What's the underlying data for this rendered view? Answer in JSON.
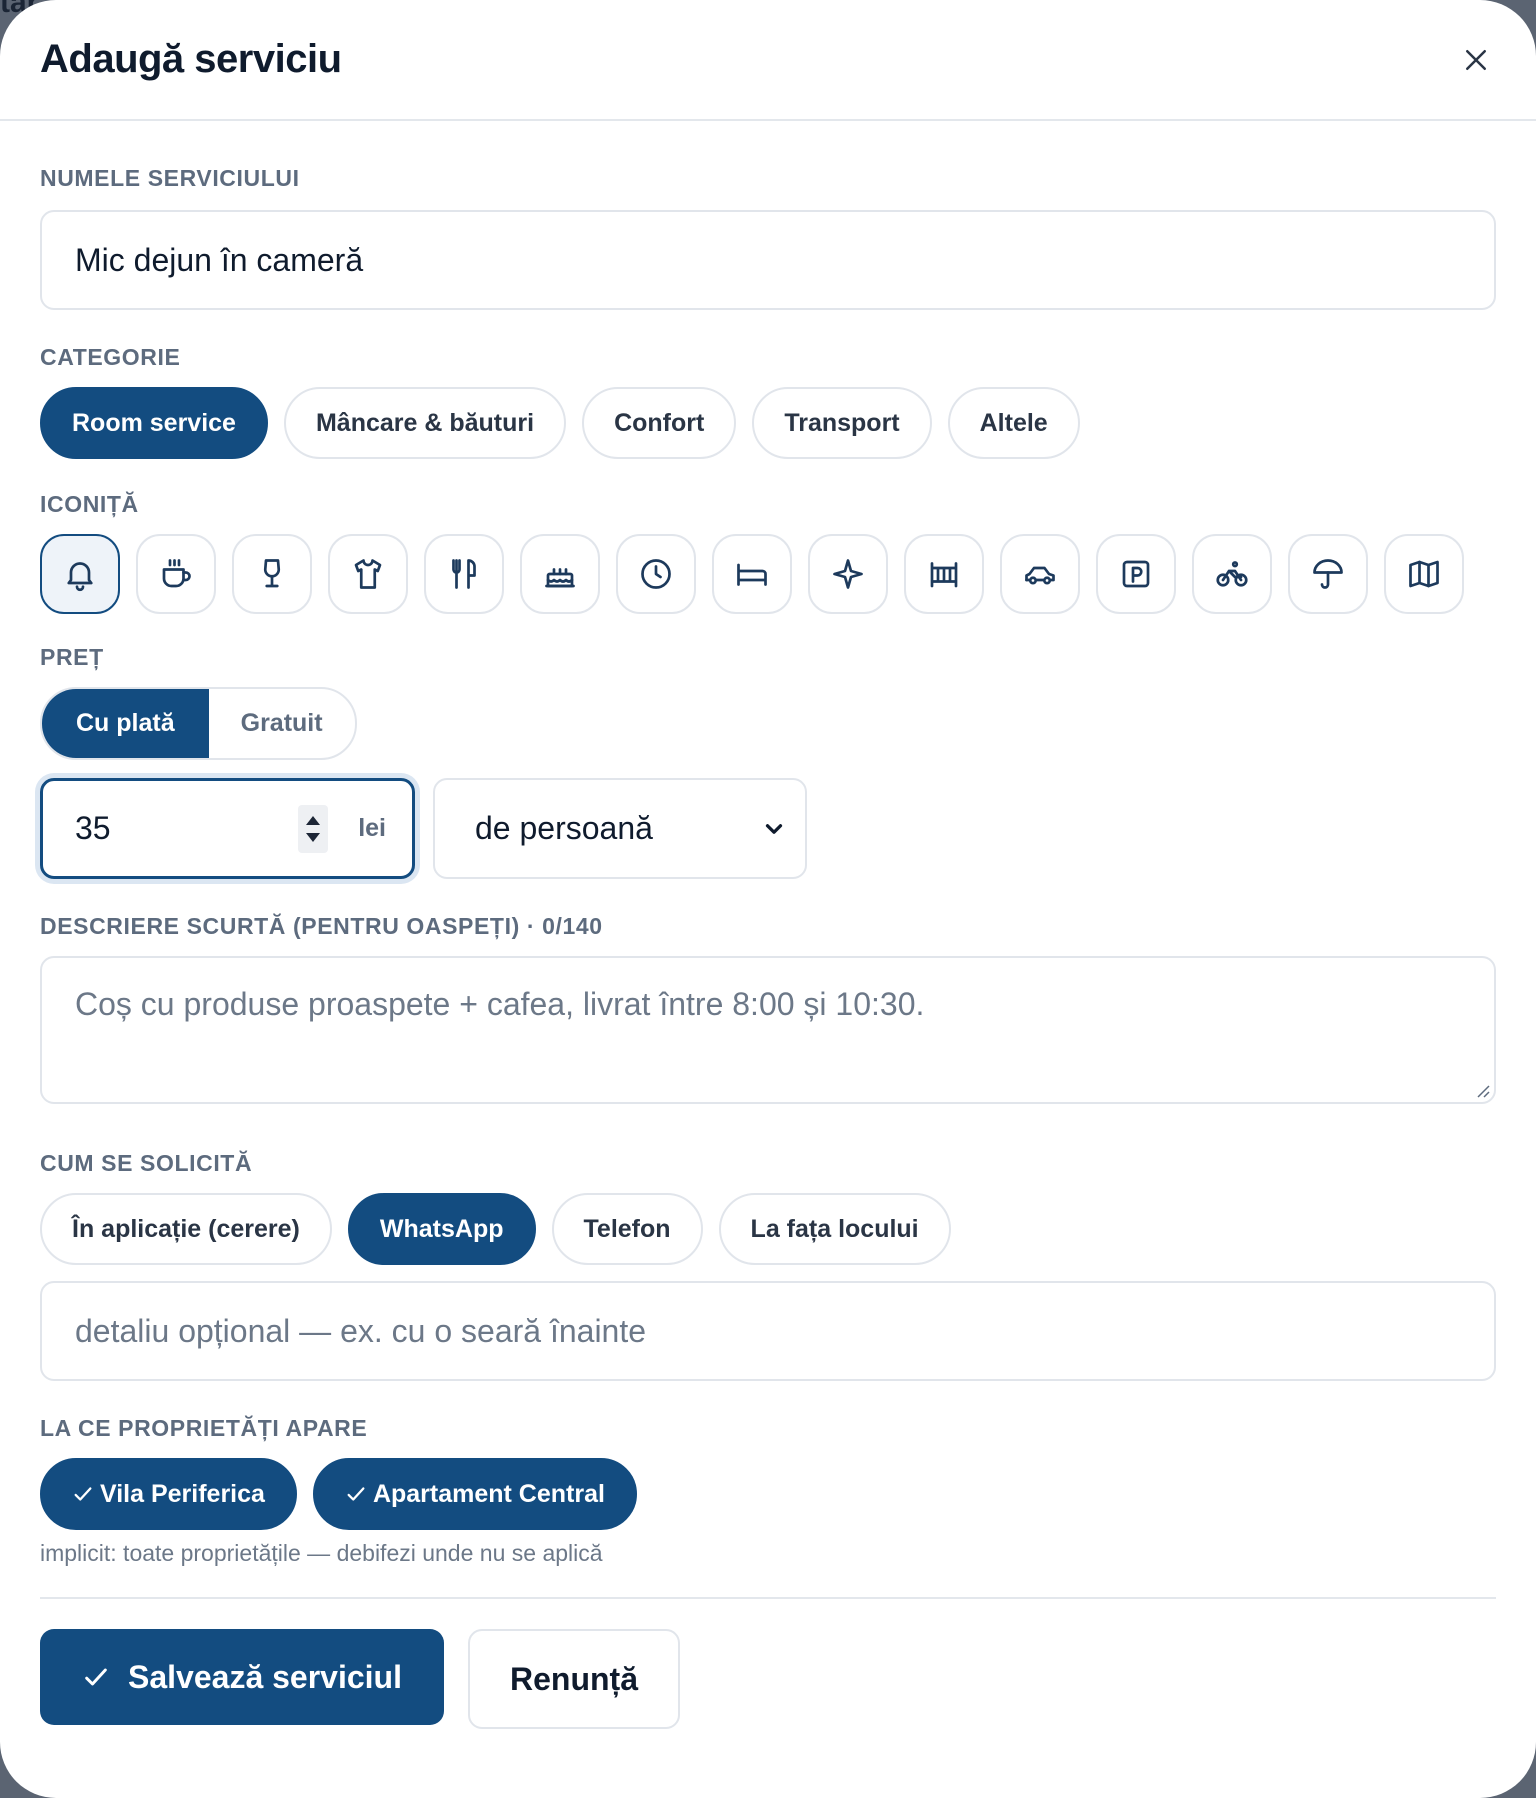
{
  "backdrop": {
    "peek_text": "tar"
  },
  "modal": {
    "title": "Adaugă serviciu"
  },
  "service_name": {
    "label": "NUMELE SERVICIULUI",
    "value": "Mic dejun în cameră"
  },
  "category": {
    "label": "CATEGORIE",
    "options": [
      "Room service",
      "Mâncare & băuturi",
      "Confort",
      "Transport",
      "Altele"
    ],
    "selected": "Room service"
  },
  "icon": {
    "label": "ICONIȚĂ",
    "options": [
      "bell-icon",
      "coffee-icon",
      "wine-glass-icon",
      "shirt-icon",
      "utensils-icon",
      "cake-icon",
      "clock-icon",
      "bed-icon",
      "sparkle-icon",
      "crib-icon",
      "car-icon",
      "parking-icon",
      "bike-icon",
      "umbrella-icon",
      "map-icon"
    ],
    "selected": "bell-icon"
  },
  "price": {
    "label": "PREȚ",
    "modes": [
      "Cu plată",
      "Gratuit"
    ],
    "selected_mode": "Cu plată",
    "amount": "35",
    "currency": "lei",
    "per": "de persoană"
  },
  "description": {
    "label": "DESCRIERE SCURTĂ (PENTRU OASPEȚI) · 0/140",
    "placeholder": "Coș cu produse proaspete + cafea, livrat între 8:00 și 10:30."
  },
  "request_method": {
    "label": "CUM SE SOLICITĂ",
    "options": [
      "În aplicație (cerere)",
      "WhatsApp",
      "Telefon",
      "La fața locului"
    ],
    "selected": "WhatsApp",
    "detail_placeholder": "detaliu opțional — ex. cu o seară înainte"
  },
  "properties": {
    "label": "LA CE PROPRIETĂȚI APARE",
    "items": [
      "Vila Periferica",
      "Apartament Central"
    ],
    "hint": "implicit: toate proprietățile — debifezi unde nu se aplică"
  },
  "actions": {
    "save_label": "Salvează serviciul",
    "cancel_label": "Renunță"
  },
  "colors": {
    "primary": "#134c80",
    "border": "#e1e5eb",
    "label": "#5d6b7e"
  }
}
